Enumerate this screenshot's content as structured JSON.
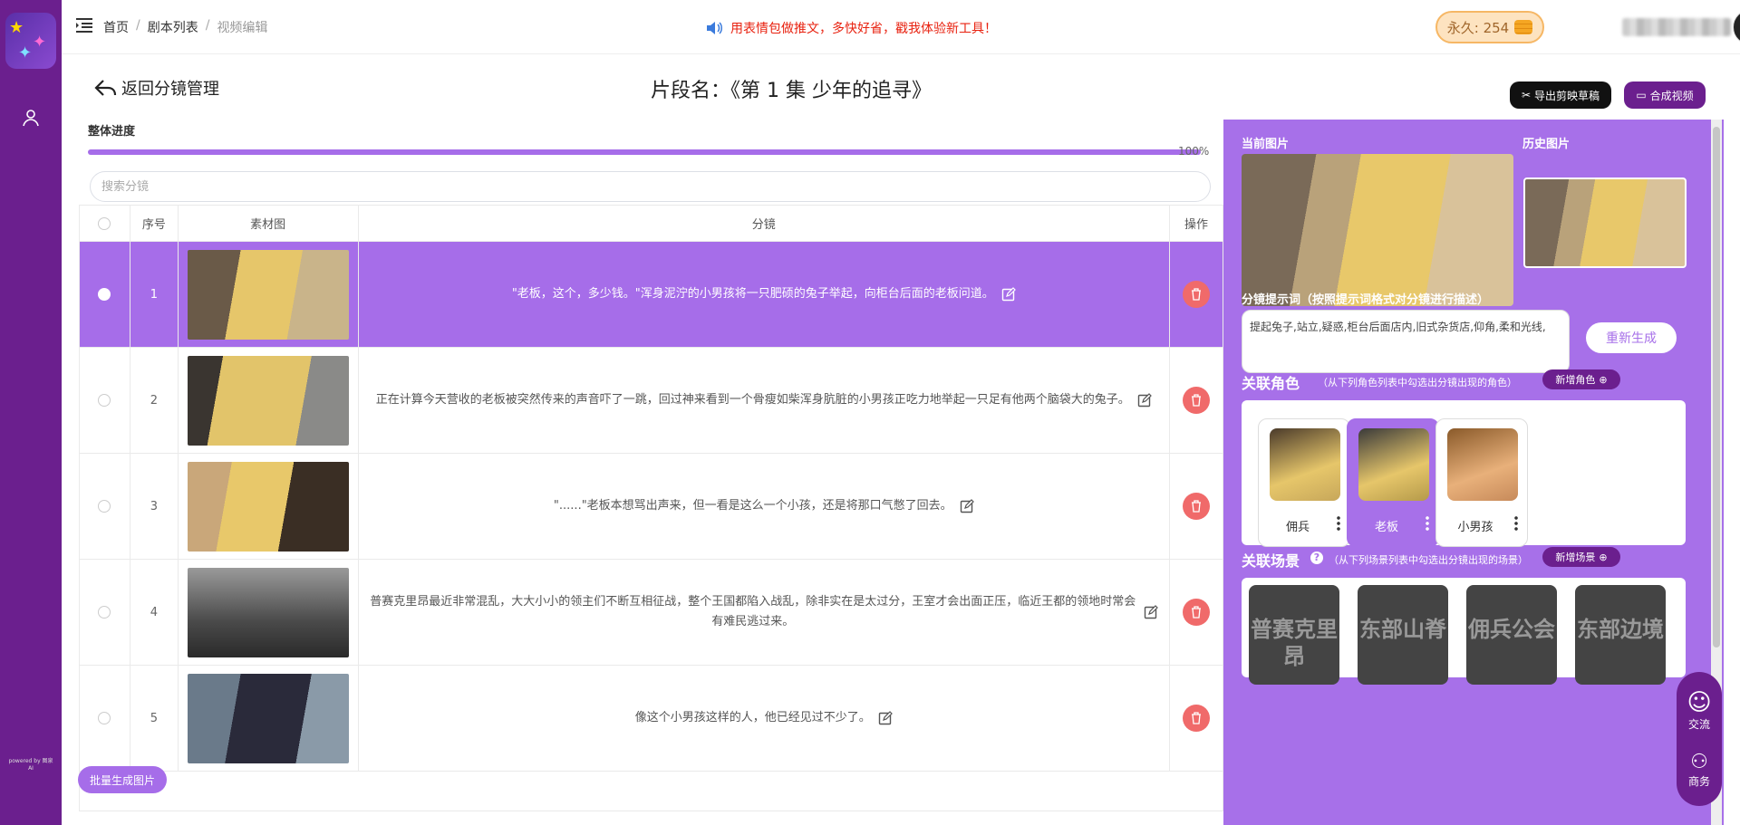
{
  "breadcrumb": {
    "home": "首页",
    "list": "剧本列表",
    "current": "视频编辑"
  },
  "notice": "用表情包做推文，多快好省，戳我体验新工具！",
  "coins": {
    "label": "永久: 254"
  },
  "powered": "powered by 图泉AI",
  "header": {
    "back": "返回分镜管理",
    "title": "片段名：《第 1 集 少年的追寻》",
    "export": "导出剪映草稿",
    "compose": "合成视频"
  },
  "progress": {
    "label": "整体进度",
    "value": 1.0,
    "percent_text": "100%"
  },
  "search": {
    "placeholder": "搜索分镜"
  },
  "table": {
    "headers": {
      "seq": "序号",
      "image": "素材图",
      "segment": "分镜",
      "action": "操作"
    },
    "rows": [
      {
        "seq": "1",
        "text": "\"老板，这个，多少钱。\"浑身泥泞的小男孩将一只肥硕的兔子举起，向柜台后面的老板问道。"
      },
      {
        "seq": "2",
        "text": "正在计算今天营收的老板被突然传来的声音吓了一跳，回过神来看到一个骨瘦如柴浑身肮脏的小男孩正吃力地举起一只足有他两个脑袋大的兔子。"
      },
      {
        "seq": "3",
        "text": "\"......\"老板本想骂出声来，但一看是这么一个小孩，还是将那口气憋了回去。"
      },
      {
        "seq": "4",
        "text": "普赛克里昂最近非常混乱，大大小小的领主们不断互相征战，整个王国都陷入战乱，除非实在是太过分，王室才会出面正压，临近王都的领地时常会有难民逃过来。"
      },
      {
        "seq": "5",
        "text": "像这个小男孩这样的人，他已经见过不少了。"
      }
    ]
  },
  "batch": "批量生成图片",
  "panel": {
    "current_image": "当前图片",
    "history_image": "历史图片",
    "prompt_label": "分镜提示词（按照提示词格式对分镜进行描述）",
    "prompt_value": "提起兔子,站立,疑惑,柜台后面店内,旧式杂货店,仰角,柔和光线,",
    "regenerate": "重新生成",
    "roles": {
      "title": "关联角色",
      "hint": "（从下列角色列表中勾选出分镜出现的角色）",
      "add": "新增角色",
      "items": [
        "佣兵",
        "老板",
        "小男孩"
      ]
    },
    "scenes": {
      "title": "关联场景",
      "hint": "（从下列场景列表中勾选出分镜出现的场景）",
      "add": "新增场景",
      "items": [
        "普赛克里昂",
        "东部山脊",
        "佣兵公会",
        "东部边境"
      ]
    }
  },
  "float": {
    "chat": "交流",
    "business": "商务"
  }
}
